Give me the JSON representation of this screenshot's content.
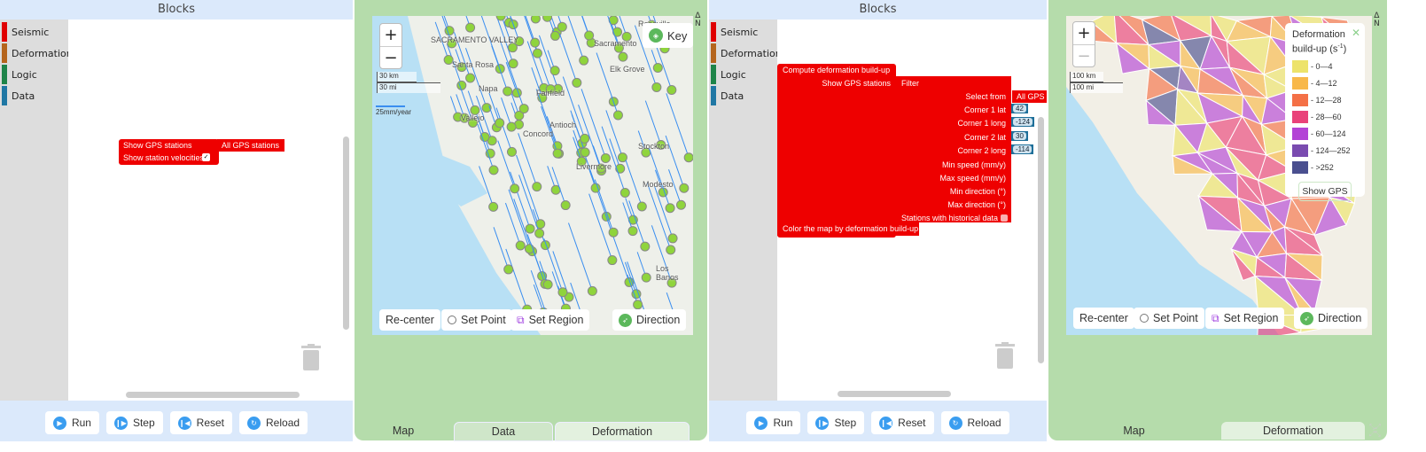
{
  "left": {
    "blocks_title": "Blocks",
    "categories": [
      {
        "label": "Seismic",
        "color": "#e00000"
      },
      {
        "label": "Deformation",
        "color": "#b5651d"
      },
      {
        "label": "Logic",
        "color": "#1e8449"
      },
      {
        "label": "Data",
        "color": "#1f77a4"
      }
    ],
    "block": {
      "show_gps": "Show GPS stations",
      "all_gps": "All GPS stations",
      "show_velocities": "Show station velocities",
      "velocities_checked": "✓"
    },
    "toolbar": {
      "run": "Run",
      "step": "Step",
      "reset": "Reset",
      "reload": "Reload"
    },
    "map": {
      "key_label": "Key",
      "scale_km": "30 km",
      "scale_mi": "30 mi",
      "velocity_scale": "25mm/year",
      "places": [
        "SACRAMENTO VALLEY",
        "Roseville",
        "Sacramento",
        "Santa Rosa",
        "Elk Grove",
        "Napa",
        "Fairfield",
        "Vallejo",
        "Antioch",
        "Concord",
        "Stockton",
        "Livermore",
        "Modesto",
        "Los Banos"
      ],
      "controls": {
        "recenter": "Re-center",
        "set_point": "Set Point",
        "set_region": "Set Region",
        "direction": "Direction"
      }
    },
    "tabs": [
      "Map",
      "Data",
      "Deformation"
    ]
  },
  "right": {
    "blocks_title": "Blocks",
    "categories": [
      {
        "label": "Seismic",
        "color": "#e00000"
      },
      {
        "label": "Deformation",
        "color": "#b5651d"
      },
      {
        "label": "Logic",
        "color": "#1e8449"
      },
      {
        "label": "Data",
        "color": "#1f77a4"
      }
    ],
    "block": {
      "compute": "Compute deformation build-up",
      "show_gps": "Show GPS stations",
      "filter": "Filter",
      "select_from": "Select from",
      "all_gps": "All GPS s",
      "corner1_lat_label": "Corner 1 lat",
      "corner1_lat": "42",
      "corner1_long_label": "Corner 1 long",
      "corner1_long": "-124",
      "corner2_lat_label": "Corner 2 lat",
      "corner2_lat": "30",
      "corner2_long_label": "Corner 2 long",
      "corner2_long": "-114",
      "min_speed": "Min speed (mm/y)",
      "max_speed": "Max speed (mm/y)",
      "min_dir": "Min direction (°)",
      "max_dir": "Max direction (°)",
      "historical": "Stations with historical data",
      "color_map": "Color the map by deformation build-up"
    },
    "toolbar": {
      "run": "Run",
      "step": "Step",
      "reset": "Reset",
      "reload": "Reload"
    },
    "map": {
      "scale_km": "100 km",
      "scale_mi": "100 mi",
      "legend": {
        "title": "Deformation build-up (s",
        "title_sup": "-1",
        "title_end": ")",
        "items": [
          {
            "label": "- 0—4",
            "color": "#ede36a"
          },
          {
            "label": "- 4—12",
            "color": "#f8b84a"
          },
          {
            "label": "- 12—28",
            "color": "#f47046"
          },
          {
            "label": "- 28—60",
            "color": "#e9427a"
          },
          {
            "label": "- 60—124",
            "color": "#b343d6"
          },
          {
            "label": "- 124—252",
            "color": "#7a4bb0"
          },
          {
            "label": "- >252",
            "color": "#4a4f8f"
          }
        ],
        "show_gps": "Show GPS"
      },
      "controls": {
        "recenter": "Re-center",
        "set_point": "Set Point",
        "set_region": "Set Region",
        "direction": "Direction"
      }
    },
    "tabs": [
      "Map",
      "Deformation"
    ]
  }
}
